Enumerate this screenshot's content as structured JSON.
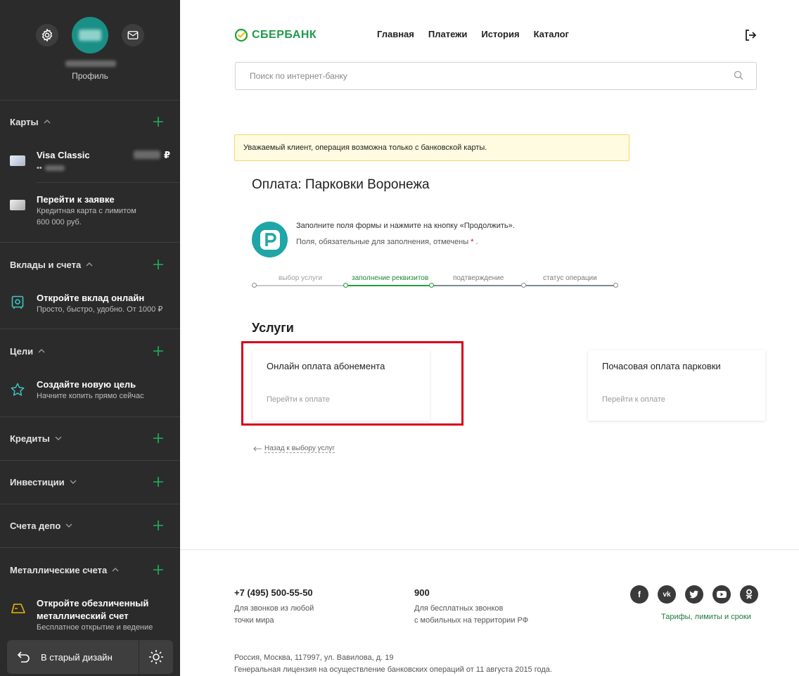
{
  "sidebar": {
    "profile_label": "Профиль",
    "sections": {
      "cards": "Карты",
      "deposits": "Вклады и счета",
      "goals": "Цели",
      "credits": "Кредиты",
      "investments": "Инвестиции",
      "depo": "Счета депо",
      "metal": "Металлические счета"
    },
    "card_visa": {
      "title": "Visa Classic",
      "currency": "₽",
      "masked": "••"
    },
    "card_apply": {
      "title": "Перейти к заявке",
      "sub1": "Кредитная карта с лимитом",
      "sub2": "600 000 руб."
    },
    "deposit_promo": {
      "title": "Откройте вклад онлайн",
      "sub": "Просто, быстро, удобно. От 1000 ₽"
    },
    "goal_promo": {
      "title": "Создайте новую цель",
      "sub": "Начните копить прямо сейчас"
    },
    "metal_promo": {
      "title1": "Откройте обезличенный",
      "title2": "металлический счет",
      "sub": "Бесплатное открытие и ведение"
    },
    "old_design": "В старый дизайн"
  },
  "header": {
    "logo": "СБЕРБАНК",
    "nav": [
      "Главная",
      "Платежи",
      "История",
      "Каталог"
    ],
    "search_placeholder": "Поиск по интернет-банку"
  },
  "notice": "Уважаемый клиент, операция возможна только с банковской карты.",
  "page_title": "Оплата: Парковки Воронежа",
  "instructions": {
    "line1": "Заполните поля формы и нажмите на кнопку «Продолжить».",
    "line2": "Поля, обязательные для заполнения, отмечены",
    "star": "*",
    "tail": "."
  },
  "steps": [
    "выбор услуги",
    "заполнение реквизитов",
    "подтверждение",
    "статус операции"
  ],
  "services": {
    "heading": "Услуги",
    "items": [
      {
        "title": "Онлайн оплата абонемента",
        "link": "Перейти к оплате"
      },
      {
        "title": "Почасовая оплата парковки",
        "link": "Перейти к оплате"
      }
    ],
    "back": "Назад к выбору услуг"
  },
  "footer": {
    "phone": "+7 (495) 500-55-50",
    "phone_sub1": "Для звонков из любой",
    "phone_sub2": "точки мира",
    "short": "900",
    "short_sub1": "Для бесплатных звонков",
    "short_sub2": "с мобильных на территории РФ",
    "tariffs": "Тарифы, лимиты и сроки",
    "address": "Россия, Москва, 117997, ул. Вавилова, д. 19",
    "license": "Генеральная лицензия на осуществление банковских операций от 11 августа 2015 года."
  },
  "colors": {
    "sidebar_bg": "#2b2b2b",
    "brand_green": "#1e9b4a",
    "highlight_red": "#d9001b",
    "notice_bg": "#fffbe0"
  }
}
